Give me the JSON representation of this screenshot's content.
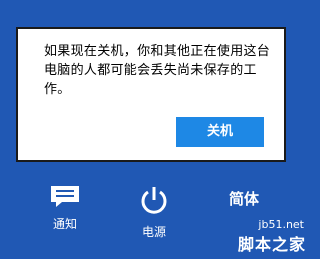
{
  "dialog": {
    "message": "如果现在关机，你和其他正在使用这台电脑的人都可能会丢失尚未保存的工作。",
    "button_label": "关机"
  },
  "charms": {
    "notify_label": "通知",
    "power_label": "电源",
    "ime_label": "简体"
  },
  "watermark": {
    "site": "jb51.net",
    "brand": "脚本之家"
  },
  "colors": {
    "background": "#2058b4",
    "button": "#1e88e5"
  }
}
